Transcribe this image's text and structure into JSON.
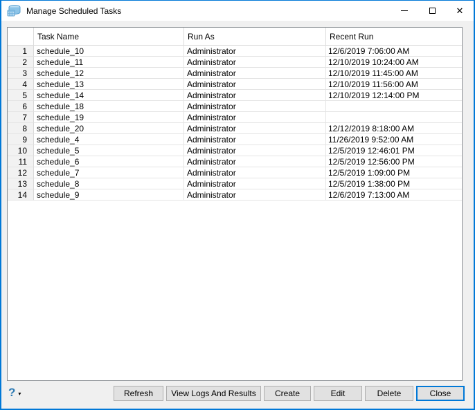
{
  "window": {
    "title": "Manage Scheduled Tasks",
    "accent_color": "#0078d7"
  },
  "icons": {
    "app_icon": "scheduled-tasks-database",
    "minimize": "minimize-line",
    "maximize": "maximize-box",
    "close_glyph": "✕",
    "help_glyph": "?",
    "help_dropdown_glyph": "▾"
  },
  "table": {
    "columns": {
      "row_header": "",
      "task_name": "Task Name",
      "run_as": "Run As",
      "recent_run": "Recent Run"
    },
    "rows": [
      {
        "num": "1",
        "task": "schedule_10",
        "run_as": "Administrator",
        "recent": "12/6/2019 7:06:00 AM"
      },
      {
        "num": "2",
        "task": "schedule_11",
        "run_as": "Administrator",
        "recent": "12/10/2019 10:24:00 AM"
      },
      {
        "num": "3",
        "task": "schedule_12",
        "run_as": "Administrator",
        "recent": "12/10/2019 11:45:00 AM"
      },
      {
        "num": "4",
        "task": "schedule_13",
        "run_as": "Administrator",
        "recent": "12/10/2019 11:56:00 AM"
      },
      {
        "num": "5",
        "task": "schedule_14",
        "run_as": "Administrator",
        "recent": "12/10/2019 12:14:00 PM"
      },
      {
        "num": "6",
        "task": "schedule_18",
        "run_as": "Administrator",
        "recent": ""
      },
      {
        "num": "7",
        "task": "schedule_19",
        "run_as": "Administrator",
        "recent": ""
      },
      {
        "num": "8",
        "task": "schedule_20",
        "run_as": "Administrator",
        "recent": "12/12/2019 8:18:00 AM"
      },
      {
        "num": "9",
        "task": "schedule_4",
        "run_as": "Administrator",
        "recent": "11/26/2019 9:52:00 AM"
      },
      {
        "num": "10",
        "task": "schedule_5",
        "run_as": "Administrator",
        "recent": "12/5/2019 12:46:01 PM"
      },
      {
        "num": "11",
        "task": "schedule_6",
        "run_as": "Administrator",
        "recent": "12/5/2019 12:56:00 PM"
      },
      {
        "num": "12",
        "task": "schedule_7",
        "run_as": "Administrator",
        "recent": "12/5/2019 1:09:00 PM"
      },
      {
        "num": "13",
        "task": "schedule_8",
        "run_as": "Administrator",
        "recent": "12/5/2019 1:38:00 PM"
      },
      {
        "num": "14",
        "task": "schedule_9",
        "run_as": "Administrator",
        "recent": "12/6/2019 7:13:00 AM"
      }
    ]
  },
  "footer": {
    "buttons": {
      "refresh": "Refresh",
      "view_logs": "View Logs And Results",
      "create": "Create",
      "edit": "Edit",
      "delete": "Delete",
      "close": "Close"
    }
  }
}
